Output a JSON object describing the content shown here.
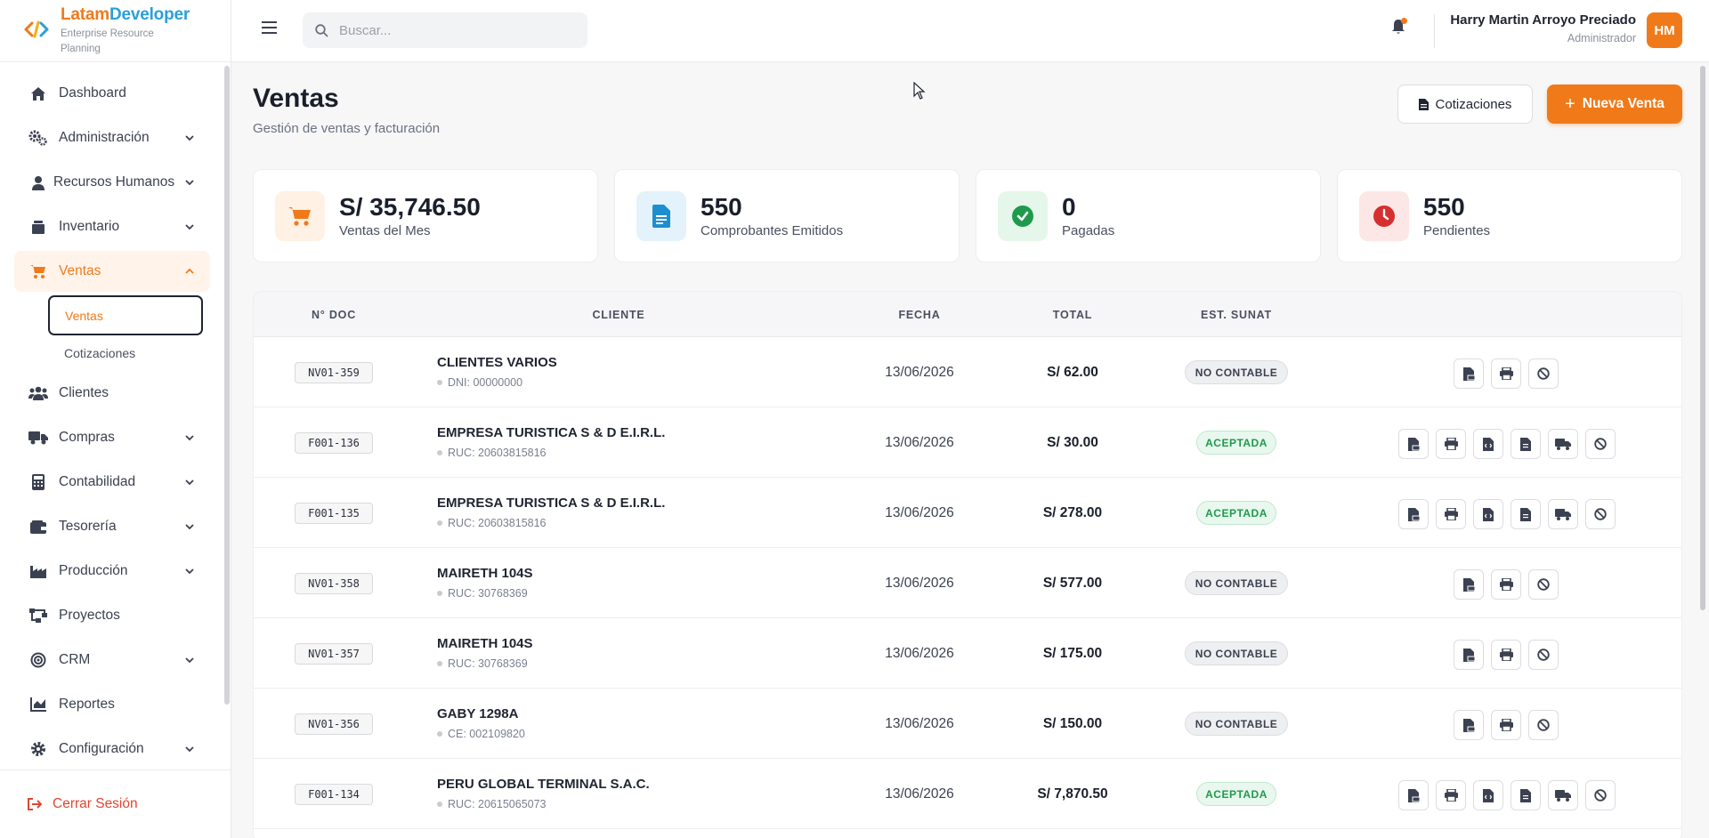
{
  "brand": {
    "name_a": "Latam",
    "name_b": "Developer",
    "subtitle": "Enterprise Resource Planning"
  },
  "sidebar": {
    "items": [
      {
        "label": "Dashboard",
        "icon": "home-icon"
      },
      {
        "label": "Administración",
        "icon": "gears-icon"
      },
      {
        "label": "Recursos Humanos",
        "icon": "user-icon"
      },
      {
        "label": "Inventario",
        "icon": "box-icon"
      },
      {
        "label": "Ventas",
        "icon": "cart-icon"
      },
      {
        "label": "Clientes",
        "icon": "users-icon"
      },
      {
        "label": "Compras",
        "icon": "truck-icon"
      },
      {
        "label": "Contabilidad",
        "icon": "calculator-icon"
      },
      {
        "label": "Tesorería",
        "icon": "wallet-icon"
      },
      {
        "label": "Producción",
        "icon": "factory-icon"
      },
      {
        "label": "Proyectos",
        "icon": "diagram-icon"
      },
      {
        "label": "CRM",
        "icon": "bullseye-icon"
      },
      {
        "label": "Reportes",
        "icon": "chart-icon"
      },
      {
        "label": "Configuración",
        "icon": "gear-icon"
      }
    ],
    "ventas_sub": [
      "Ventas",
      "Cotizaciones"
    ],
    "logout": "Cerrar Sesión"
  },
  "header": {
    "search_placeholder": "Buscar...",
    "user_name": "Harry Martin Arroyo Preciado",
    "user_role": "Administrador",
    "avatar_initials": "HM"
  },
  "page": {
    "title": "Ventas",
    "subtitle": "Gestión de ventas y facturación",
    "btn_cotizaciones": "Cotizaciones",
    "btn_nueva": "Nueva Venta"
  },
  "stats": [
    {
      "value": "S/ 35,746.50",
      "label": "Ventas del Mes"
    },
    {
      "value": "550",
      "label": "Comprobantes Emitidos"
    },
    {
      "value": "0",
      "label": "Pagadas"
    },
    {
      "value": "550",
      "label": "Pendientes"
    }
  ],
  "table": {
    "headers": {
      "doc": "N° DOC",
      "cliente": "CLIENTE",
      "fecha": "FECHA",
      "total": "TOTAL",
      "sunat": "EST. SUNAT"
    },
    "rows": [
      {
        "doc": "NV01-359",
        "cliente": "CLIENTES VARIOS",
        "id": "DNI: 00000000",
        "fecha": "13/06/2026",
        "total": "S/ 62.00",
        "sunat": "NO CONTABLE"
      },
      {
        "doc": "F001-136",
        "cliente": "EMPRESA TURISTICA S & D E.I.R.L.",
        "id": "RUC: 20603815816",
        "fecha": "13/06/2026",
        "total": "S/ 30.00",
        "sunat": "ACEPTADA"
      },
      {
        "doc": "F001-135",
        "cliente": "EMPRESA TURISTICA S & D E.I.R.L.",
        "id": "RUC: 20603815816",
        "fecha": "13/06/2026",
        "total": "S/ 278.00",
        "sunat": "ACEPTADA"
      },
      {
        "doc": "NV01-358",
        "cliente": "MAIRETH 104S",
        "id": "RUC: 30768369",
        "fecha": "13/06/2026",
        "total": "S/ 577.00",
        "sunat": "NO CONTABLE"
      },
      {
        "doc": "NV01-357",
        "cliente": "MAIRETH 104S",
        "id": "RUC: 30768369",
        "fecha": "13/06/2026",
        "total": "S/ 175.00",
        "sunat": "NO CONTABLE"
      },
      {
        "doc": "NV01-356",
        "cliente": "GABY 1298A",
        "id": "CE: 002109820",
        "fecha": "13/06/2026",
        "total": "S/ 150.00",
        "sunat": "NO CONTABLE"
      },
      {
        "doc": "F001-134",
        "cliente": "PERU GLOBAL TERMINAL S.A.C.",
        "id": "RUC: 20615065073",
        "fecha": "13/06/2026",
        "total": "S/ 7,870.50",
        "sunat": "ACEPTADA"
      }
    ]
  },
  "colors": {
    "accent": "#f07a1a",
    "brand_blue": "#2a9fd8",
    "success": "#1f9a4c",
    "danger": "#e0462f"
  }
}
